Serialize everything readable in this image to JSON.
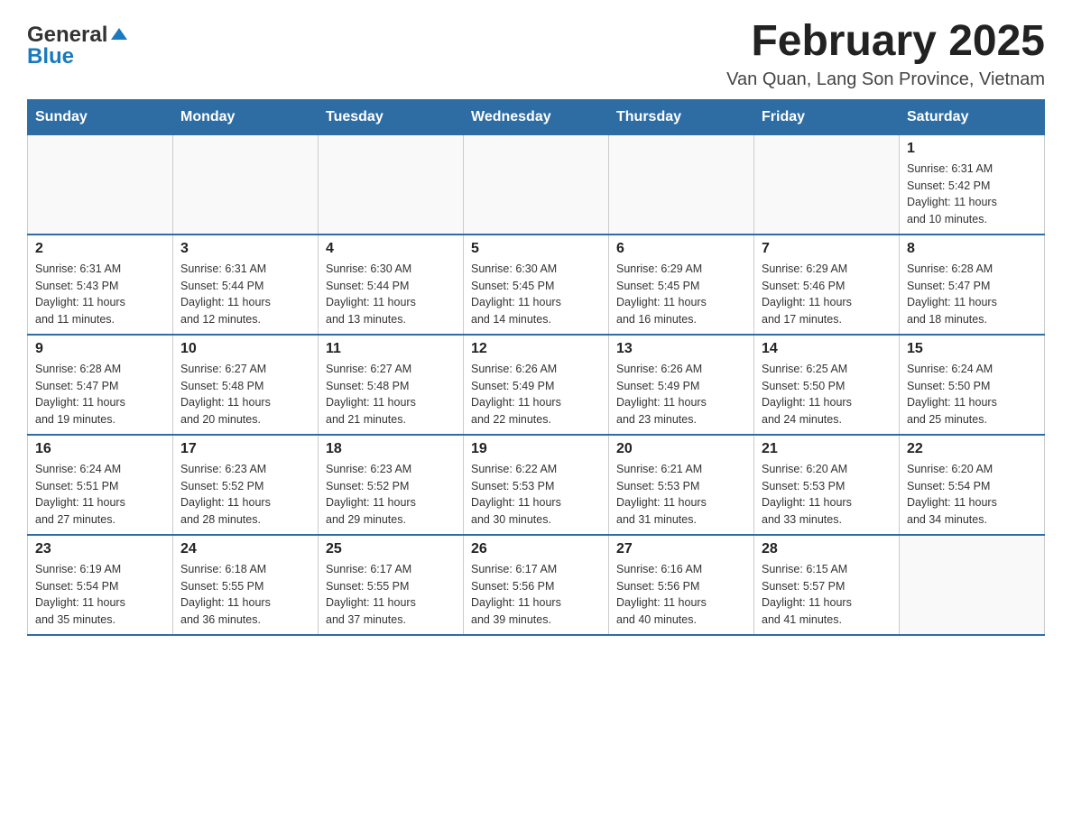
{
  "header": {
    "logo_general": "General",
    "logo_blue": "Blue",
    "title": "February 2025",
    "subtitle": "Van Quan, Lang Son Province, Vietnam"
  },
  "weekdays": [
    "Sunday",
    "Monday",
    "Tuesday",
    "Wednesday",
    "Thursday",
    "Friday",
    "Saturday"
  ],
  "weeks": [
    [
      {
        "day": "",
        "info": ""
      },
      {
        "day": "",
        "info": ""
      },
      {
        "day": "",
        "info": ""
      },
      {
        "day": "",
        "info": ""
      },
      {
        "day": "",
        "info": ""
      },
      {
        "day": "",
        "info": ""
      },
      {
        "day": "1",
        "info": "Sunrise: 6:31 AM\nSunset: 5:42 PM\nDaylight: 11 hours\nand 10 minutes."
      }
    ],
    [
      {
        "day": "2",
        "info": "Sunrise: 6:31 AM\nSunset: 5:43 PM\nDaylight: 11 hours\nand 11 minutes."
      },
      {
        "day": "3",
        "info": "Sunrise: 6:31 AM\nSunset: 5:44 PM\nDaylight: 11 hours\nand 12 minutes."
      },
      {
        "day": "4",
        "info": "Sunrise: 6:30 AM\nSunset: 5:44 PM\nDaylight: 11 hours\nand 13 minutes."
      },
      {
        "day": "5",
        "info": "Sunrise: 6:30 AM\nSunset: 5:45 PM\nDaylight: 11 hours\nand 14 minutes."
      },
      {
        "day": "6",
        "info": "Sunrise: 6:29 AM\nSunset: 5:45 PM\nDaylight: 11 hours\nand 16 minutes."
      },
      {
        "day": "7",
        "info": "Sunrise: 6:29 AM\nSunset: 5:46 PM\nDaylight: 11 hours\nand 17 minutes."
      },
      {
        "day": "8",
        "info": "Sunrise: 6:28 AM\nSunset: 5:47 PM\nDaylight: 11 hours\nand 18 minutes."
      }
    ],
    [
      {
        "day": "9",
        "info": "Sunrise: 6:28 AM\nSunset: 5:47 PM\nDaylight: 11 hours\nand 19 minutes."
      },
      {
        "day": "10",
        "info": "Sunrise: 6:27 AM\nSunset: 5:48 PM\nDaylight: 11 hours\nand 20 minutes."
      },
      {
        "day": "11",
        "info": "Sunrise: 6:27 AM\nSunset: 5:48 PM\nDaylight: 11 hours\nand 21 minutes."
      },
      {
        "day": "12",
        "info": "Sunrise: 6:26 AM\nSunset: 5:49 PM\nDaylight: 11 hours\nand 22 minutes."
      },
      {
        "day": "13",
        "info": "Sunrise: 6:26 AM\nSunset: 5:49 PM\nDaylight: 11 hours\nand 23 minutes."
      },
      {
        "day": "14",
        "info": "Sunrise: 6:25 AM\nSunset: 5:50 PM\nDaylight: 11 hours\nand 24 minutes."
      },
      {
        "day": "15",
        "info": "Sunrise: 6:24 AM\nSunset: 5:50 PM\nDaylight: 11 hours\nand 25 minutes."
      }
    ],
    [
      {
        "day": "16",
        "info": "Sunrise: 6:24 AM\nSunset: 5:51 PM\nDaylight: 11 hours\nand 27 minutes."
      },
      {
        "day": "17",
        "info": "Sunrise: 6:23 AM\nSunset: 5:52 PM\nDaylight: 11 hours\nand 28 minutes."
      },
      {
        "day": "18",
        "info": "Sunrise: 6:23 AM\nSunset: 5:52 PM\nDaylight: 11 hours\nand 29 minutes."
      },
      {
        "day": "19",
        "info": "Sunrise: 6:22 AM\nSunset: 5:53 PM\nDaylight: 11 hours\nand 30 minutes."
      },
      {
        "day": "20",
        "info": "Sunrise: 6:21 AM\nSunset: 5:53 PM\nDaylight: 11 hours\nand 31 minutes."
      },
      {
        "day": "21",
        "info": "Sunrise: 6:20 AM\nSunset: 5:53 PM\nDaylight: 11 hours\nand 33 minutes."
      },
      {
        "day": "22",
        "info": "Sunrise: 6:20 AM\nSunset: 5:54 PM\nDaylight: 11 hours\nand 34 minutes."
      }
    ],
    [
      {
        "day": "23",
        "info": "Sunrise: 6:19 AM\nSunset: 5:54 PM\nDaylight: 11 hours\nand 35 minutes."
      },
      {
        "day": "24",
        "info": "Sunrise: 6:18 AM\nSunset: 5:55 PM\nDaylight: 11 hours\nand 36 minutes."
      },
      {
        "day": "25",
        "info": "Sunrise: 6:17 AM\nSunset: 5:55 PM\nDaylight: 11 hours\nand 37 minutes."
      },
      {
        "day": "26",
        "info": "Sunrise: 6:17 AM\nSunset: 5:56 PM\nDaylight: 11 hours\nand 39 minutes."
      },
      {
        "day": "27",
        "info": "Sunrise: 6:16 AM\nSunset: 5:56 PM\nDaylight: 11 hours\nand 40 minutes."
      },
      {
        "day": "28",
        "info": "Sunrise: 6:15 AM\nSunset: 5:57 PM\nDaylight: 11 hours\nand 41 minutes."
      },
      {
        "day": "",
        "info": ""
      }
    ]
  ]
}
